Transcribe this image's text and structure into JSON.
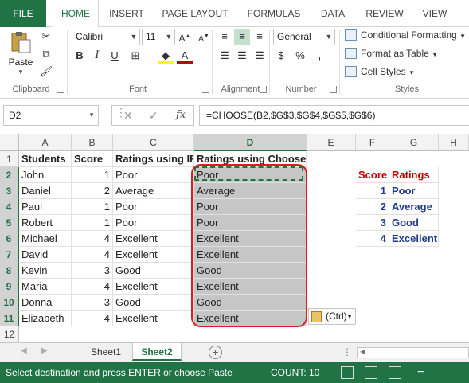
{
  "ribbon_tabs": [
    "FILE",
    "HOME",
    "INSERT",
    "PAGE LAYOUT",
    "FORMULAS",
    "DATA",
    "REVIEW",
    "VIEW"
  ],
  "clipboard": {
    "paste_label": "Paste",
    "group_label": "Clipboard"
  },
  "font": {
    "name": "Calibri",
    "size": "11",
    "group_label": "Font"
  },
  "alignment": {
    "group_label": "Alignment"
  },
  "number": {
    "format": "General",
    "group_label": "Number"
  },
  "styles": {
    "conditional": "Conditional Formatting",
    "table": "Format as Table",
    "cell": "Cell Styles",
    "group_label": "Styles"
  },
  "formula_bar": {
    "name_box": "D2",
    "fx": "fx",
    "formula": "=CHOOSE(B2,$G$3,$G$4,$G$5,$G$6)"
  },
  "columns": [
    "A",
    "B",
    "C",
    "D",
    "E",
    "F",
    "G",
    "H"
  ],
  "rows": [
    "1",
    "2",
    "3",
    "4",
    "5",
    "6",
    "7",
    "8",
    "9",
    "10",
    "11",
    "12"
  ],
  "headers": {
    "a": "Students",
    "b": "Score",
    "c": "Ratings using IF",
    "d": "Ratings using Choose"
  },
  "students": [
    {
      "name": "John",
      "score": "1",
      "if": "Poor",
      "choose": "Poor"
    },
    {
      "name": "Daniel",
      "score": "2",
      "if": "Average",
      "choose": "Average"
    },
    {
      "name": "Paul",
      "score": "1",
      "if": "Poor",
      "choose": "Poor"
    },
    {
      "name": "Robert",
      "score": "1",
      "if": "Poor",
      "choose": "Poor"
    },
    {
      "name": "Michael",
      "score": "4",
      "if": "Excellent",
      "choose": "Excellent"
    },
    {
      "name": "David",
      "score": "4",
      "if": "Excellent",
      "choose": "Excellent"
    },
    {
      "name": "Kevin",
      "score": "3",
      "if": "Good",
      "choose": "Good"
    },
    {
      "name": "Maria",
      "score": "4",
      "if": "Excellent",
      "choose": "Excellent"
    },
    {
      "name": "Donna",
      "score": "3",
      "if": "Good",
      "choose": "Good"
    },
    {
      "name": "Elizabeth",
      "score": "4",
      "if": "Excellent",
      "choose": "Excellent"
    }
  ],
  "lookup": {
    "score_header": "Score",
    "ratings_header": "Ratings",
    "entries": [
      {
        "score": "1",
        "rating": "Poor"
      },
      {
        "score": "2",
        "rating": "Average"
      },
      {
        "score": "3",
        "rating": "Good"
      },
      {
        "score": "4",
        "rating": "Excellent"
      }
    ]
  },
  "paste_options": "(Ctrl)",
  "sheets": [
    "Sheet1",
    "Sheet2"
  ],
  "active_sheet": "Sheet2",
  "status": {
    "message": "Select destination and press ENTER or choose Paste",
    "count": "COUNT: 10"
  },
  "colors": {
    "accent": "#217346",
    "selection_oval": "#e01b1b",
    "lookup_header": "#c00000",
    "lookup_value": "#1f3d8a"
  }
}
